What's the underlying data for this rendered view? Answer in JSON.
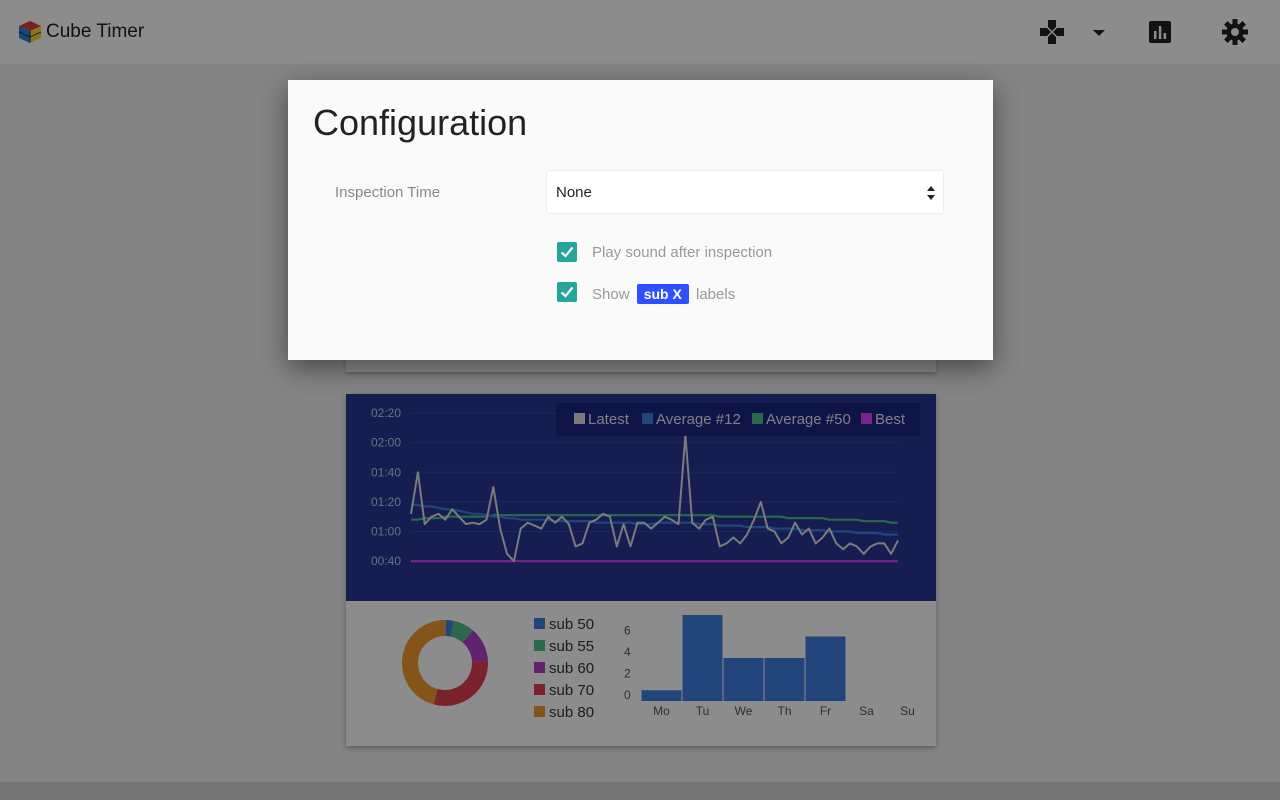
{
  "app": {
    "title": "Cube Timer"
  },
  "toolbar": {
    "icons": [
      "gamepad-icon",
      "caret-down-icon",
      "bar-chart-icon",
      "gear-icon"
    ]
  },
  "modal": {
    "title": "Configuration",
    "inspection_label": "Inspection Time",
    "inspection_value": "None",
    "play_sound_label": "Play sound after inspection",
    "play_sound_checked": true,
    "show_labels_prefix": "Show",
    "show_labels_badge": "sub X",
    "show_labels_suffix": "labels",
    "show_labels_checked": true,
    "accent": "#26a69a",
    "badge_color": "#304ffe"
  },
  "chart_data": [
    {
      "type": "line",
      "ytick_labels": [
        "00:40",
        "01:00",
        "01:20",
        "01:40",
        "02:00",
        "02:20"
      ],
      "ylim": [
        30,
        140
      ],
      "legend": [
        "Latest",
        "Average #12",
        "Average #50",
        "Best"
      ],
      "legend_position": "top-right",
      "series": [
        {
          "name": "Latest",
          "color": "#e0e0e0",
          "values": [
            72,
            100,
            65,
            70,
            72,
            68,
            75,
            70,
            65,
            66,
            65,
            68,
            90,
            62,
            45,
            40,
            62,
            66,
            64,
            62,
            70,
            66,
            70,
            65,
            50,
            52,
            66,
            68,
            72,
            70,
            50,
            65,
            50,
            66,
            66,
            62,
            66,
            70,
            68,
            65,
            125,
            66,
            62,
            68,
            70,
            50,
            52,
            56,
            52,
            58,
            68,
            80,
            62,
            60,
            52,
            56,
            66,
            58,
            62,
            52,
            56,
            62,
            52,
            48,
            52,
            50,
            45,
            50,
            52,
            52,
            45,
            54
          ]
        },
        {
          "name": "Average #12",
          "color": "#3f7fe0",
          "values": [
            78,
            78,
            77,
            77,
            76,
            75,
            75,
            74,
            73,
            72,
            72,
            71,
            70,
            70,
            69,
            69,
            68,
            68,
            68,
            68,
            68,
            67,
            67,
            67,
            67,
            67,
            67,
            66,
            66,
            66,
            66,
            66,
            66,
            65,
            65,
            65,
            66,
            66,
            66,
            66,
            66,
            66,
            65,
            65,
            65,
            64,
            64,
            64,
            64,
            63,
            63,
            63,
            63,
            62,
            62,
            62,
            62,
            61,
            61,
            61,
            61,
            60,
            60,
            60,
            60,
            59,
            59,
            59,
            59,
            58,
            58,
            58
          ]
        },
        {
          "name": "Average #50",
          "color": "#4fc08d",
          "values": [
            68,
            68,
            69,
            69,
            69,
            70,
            70,
            70,
            70,
            70,
            70,
            70,
            71,
            71,
            71,
            71,
            71,
            71,
            71,
            71,
            71,
            71,
            71,
            71,
            71,
            71,
            71,
            71,
            71,
            71,
            71,
            71,
            71,
            71,
            71,
            71,
            71,
            71,
            71,
            71,
            71,
            71,
            71,
            71,
            71,
            70,
            70,
            70,
            70,
            70,
            70,
            70,
            70,
            70,
            70,
            69,
            69,
            69,
            69,
            69,
            69,
            68,
            68,
            68,
            68,
            68,
            67,
            67,
            67,
            67,
            66,
            66
          ]
        },
        {
          "name": "Best",
          "color": "#e040fb",
          "values": [
            40,
            40,
            40,
            40,
            40,
            40,
            40,
            40,
            40,
            40,
            40,
            40,
            40,
            40,
            40,
            40,
            40,
            40,
            40,
            40,
            40,
            40,
            40,
            40,
            40,
            40,
            40,
            40,
            40,
            40,
            40,
            40,
            40,
            40,
            40,
            40,
            40,
            40,
            40,
            40,
            40,
            40,
            40,
            40,
            40,
            40,
            40,
            40,
            40,
            40,
            40,
            40,
            40,
            40,
            40,
            40,
            40,
            40,
            40,
            40,
            40,
            40,
            40,
            40,
            40,
            40,
            40,
            40,
            40,
            40,
            40,
            40
          ]
        }
      ]
    },
    {
      "type": "pie",
      "labels": [
        "sub 50",
        "sub 55",
        "sub 60",
        "sub 70",
        "sub 80"
      ],
      "colors": [
        "#3f7fe0",
        "#4fc08d",
        "#b040c8",
        "#e04050",
        "#f09a30"
      ],
      "values": [
        3,
        8,
        13,
        30,
        46
      ]
    },
    {
      "type": "bar",
      "categories": [
        "Mo",
        "Tu",
        "We",
        "Th",
        "Fr",
        "Sa",
        "Su"
      ],
      "values": [
        1,
        8,
        4,
        4,
        6,
        0,
        0
      ],
      "ytick_labels": [
        "0",
        "2",
        "4",
        "6"
      ],
      "ylim": [
        0,
        8
      ],
      "color": "#3f7fe0"
    }
  ]
}
